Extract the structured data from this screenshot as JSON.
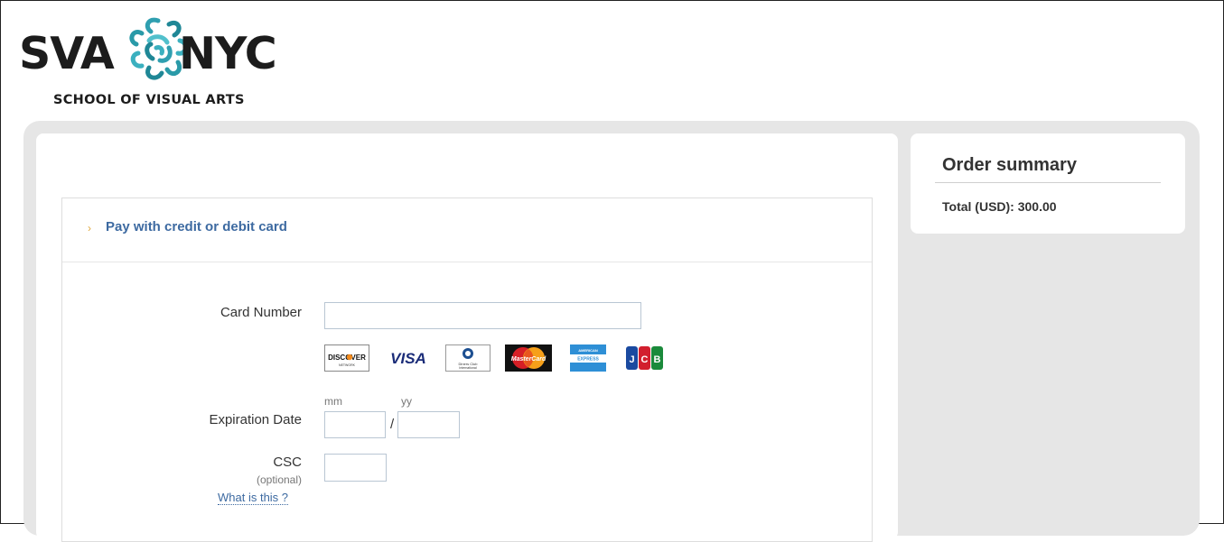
{
  "header": {
    "logo_left": "SVA",
    "logo_right": "NYC",
    "logo_subtitle": "SCHOOL OF VISUAL ARTS"
  },
  "order_summary": {
    "title": "Order summary",
    "total": "Total (USD): 300.00"
  },
  "payment": {
    "method_title": "Pay with credit or debit card",
    "card_number_label": "Card Number",
    "card_number_value": "",
    "card_brands": [
      "DISCOVER",
      "VISA",
      "Diners Club International",
      "MasterCard",
      "American Express",
      "JCB"
    ],
    "expiration_label": "Expiration Date",
    "month_hint": "mm",
    "year_hint": "yy",
    "month_value": "",
    "year_value": "",
    "date_separator": "/",
    "csc_label": "CSC",
    "csc_optional": "(optional)",
    "csc_value": "",
    "csc_help_link": "What is this ?"
  },
  "colors": {
    "link_blue": "#3d6aa1",
    "chevron_orange": "#e0a83e",
    "frame_gray": "#e6e6e6",
    "logo_teal": "#2a9aa8"
  }
}
